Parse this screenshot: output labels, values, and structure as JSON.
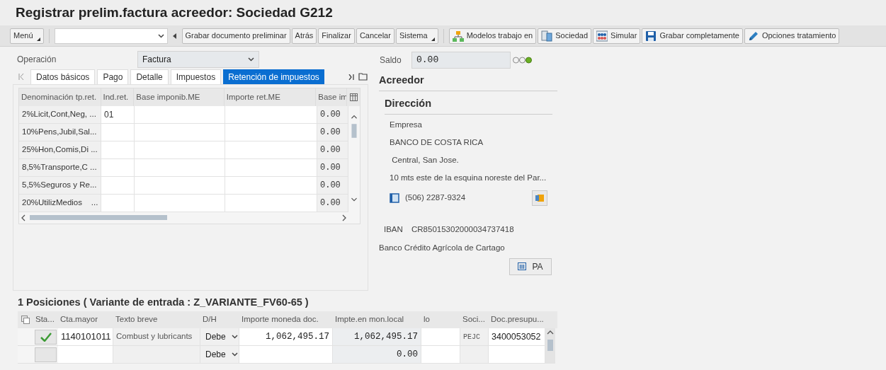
{
  "window": {
    "title": "Registrar prelim.factura acreedor: Sociedad G212"
  },
  "toolbar": {
    "menu": {
      "label": "Menú",
      "dropdown": true
    },
    "buttons": [
      {
        "label": "Grabar documento preliminar",
        "kind": "plain",
        "dropdown": false
      },
      {
        "label": "Atrás",
        "kind": "plain",
        "dropdown": false
      },
      {
        "label": "Finalizar",
        "kind": "plain",
        "dropdown": false
      },
      {
        "label": "Cancelar",
        "kind": "plain",
        "dropdown": false
      },
      {
        "label": "Sistema",
        "kind": "plain",
        "dropdown": true
      },
      {
        "label": "Modelos trabajo en",
        "kind": "hierarchy",
        "dropdown": false
      },
      {
        "label": "Sociedad",
        "kind": "document",
        "dropdown": false
      },
      {
        "label": "Simular",
        "kind": "grid",
        "dropdown": false
      },
      {
        "label": "Grabar completamente",
        "kind": "save",
        "dropdown": false
      },
      {
        "label": "Opciones tratamiento",
        "kind": "pencil",
        "dropdown": false
      }
    ]
  },
  "operation": {
    "label": "Operación",
    "value": "Factura"
  },
  "tabs": [
    {
      "label": "Datos básicos",
      "selected": false
    },
    {
      "label": "Pago",
      "selected": false
    },
    {
      "label": "Detalle",
      "selected": false
    },
    {
      "label": "Impuestos",
      "selected": false
    },
    {
      "label": "Retención de impuestos",
      "selected": true
    }
  ],
  "withholding_table": {
    "columns": [
      "Denominación tp.ret.",
      "Ind.ret.",
      "Base imponib.ME",
      "Importe ret.ME",
      "Base im"
    ],
    "rows": [
      [
        "2%Licit,Cont,Neg, ...",
        "01",
        "",
        "",
        "0.00"
      ],
      [
        "10%Pens,Jubil,Sal...",
        "",
        "",
        "",
        "0.00"
      ],
      [
        "25%Hon,Comis,Di ...",
        "",
        "",
        "",
        "0.00"
      ],
      [
        "8,5%Transporte,C ...",
        "",
        "",
        "",
        "0.00"
      ],
      [
        "5,5%Seguros y Re...",
        "",
        "",
        "",
        "0.00"
      ],
      [
        "20%UtilizMedios    ...",
        "",
        "",
        "",
        "0.00"
      ]
    ]
  },
  "balance": {
    "label": "Saldo",
    "value": "0.00",
    "lights": [
      {
        "on": false
      },
      {
        "on": false
      },
      {
        "on": true
      }
    ]
  },
  "vendor": {
    "heading": "Acreedor",
    "address_heading": "Dirección",
    "address_lines": [
      "Empresa",
      "BANCO DE COSTA RICA",
      " Central, San Jose.",
      "10 mts este de la esquina noreste del Par..."
    ],
    "phone": "(506) 2287-9324",
    "iban_label": "IBAN",
    "iban": "CR85015302000034737418",
    "bank": "Banco Crédito Agrícola de Cartago",
    "bank_button": "PA"
  },
  "positions": {
    "title": "1 Posiciones ( Variante de entrada : Z_VARIANTE_FV60-65 )",
    "columns": [
      "Sta...",
      "Cta.mayor",
      "Texto breve",
      "D/H",
      "Importe moneda doc.",
      "Impte.en mon.local",
      "lo",
      "Soci...",
      "Doc.presupu..."
    ],
    "rows": [
      {
        "checked": true,
        "account": "1140101011",
        "text": "Combust y lubricants",
        "dh": "Debe",
        "amount_doc": "1,062,495.17",
        "amount_local": "1,062,495.17",
        "lo": "",
        "company": "PEJC",
        "budget_doc": "3400053052"
      },
      {
        "checked": false,
        "account": "",
        "text": "",
        "dh": "Debe",
        "amount_doc": "",
        "amount_local": "0.00",
        "lo": "",
        "company": "",
        "budget_doc": ""
      }
    ]
  }
}
